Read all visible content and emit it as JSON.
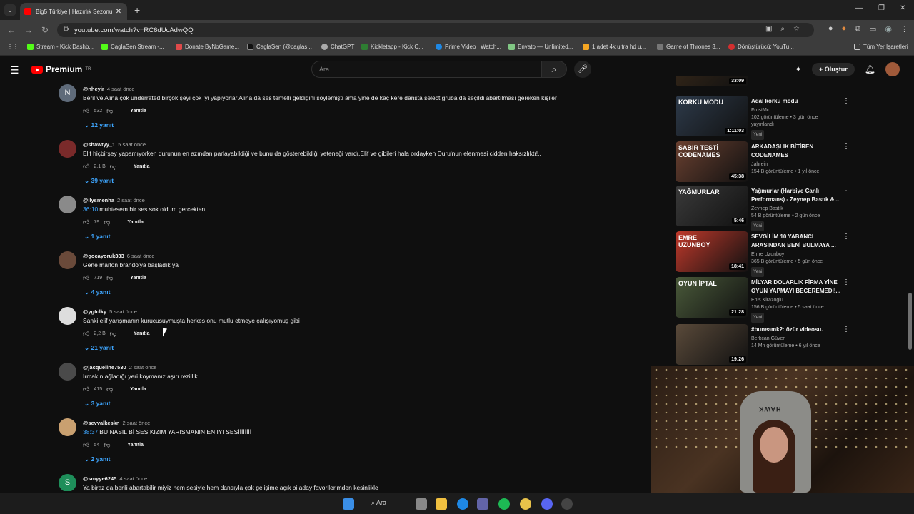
{
  "browser": {
    "tab_title": "Big5 Türkiye | Hazırlık Sezonu 5",
    "url": "youtube.com/watch?v=RC6dUcAdwQQ",
    "bookmarks": [
      "Stream - Kick Dashb...",
      "CaglaSen Stream -...",
      "Donate ByNoGame...",
      "CaglaSen (@caglas...",
      "ChatGPT",
      "Kickletapp - Kick C...",
      "Prime Video | Watch...",
      "Envato — Unlimited...",
      "1 adet 4k ultra hd u...",
      "Game of Thrones 3...",
      "Dönüştürücü: YouTu..."
    ],
    "all_bookmarks": "Tüm Yer İşaretleri"
  },
  "youtube": {
    "logo_text": "Premium",
    "logo_sup": "TR",
    "search_placeholder": "Ara",
    "create_label": "Oluştur",
    "reply_label": "Yanıtla"
  },
  "comments": [
    {
      "author": "@nheyir",
      "time": "4 saat önce",
      "text": "Beril ve Alina çok underrated birçok şeyi çok iyi yapıyorlar Alina da ses temelli geldiğini söylemişti ama yine de kaç kere dansta select gruba da seçildi abartılması gereken kişiler",
      "ts": "",
      "likes": "532",
      "replies": "12 yanıt",
      "avatar_letter": "N",
      "avatar_color": "#5f6b7a"
    },
    {
      "author": "@shawtyy_1",
      "time": "5 saat önce",
      "text": "Elif hiçbirşey yapamıyorken durunun en azından parlayabildiği ve bunu da gösterebildiği yeteneği vardı,Elif ve gibileri hala ordayken Duru'nun elenmesi cidden haksızlıktı!..",
      "ts": "",
      "likes": "2,1 B",
      "replies": "39 yanıt",
      "avatar_letter": "",
      "avatar_color": "#7a2a2a"
    },
    {
      "author": "@ilysmenha",
      "time": "2 saat önce",
      "text": "muhtesem bir ses sok oldum gercekten",
      "ts": "36:10",
      "likes": "79",
      "replies": "1 yanıt",
      "avatar_letter": "",
      "avatar_color": "#8a8a8a"
    },
    {
      "author": "@gocayoruk333",
      "time": "6 saat önce",
      "text": "Gene marlon brando'ya başladık ya",
      "ts": "",
      "likes": "719",
      "replies": "4 yanıt",
      "avatar_letter": "",
      "avatar_color": "#6a4a3a"
    },
    {
      "author": "@ygtclky",
      "time": "5 saat önce",
      "text": "Sanki elif yarışmanın kurucusuymuşta herkes onu mutlu etmeye çalışıyomuş gibi",
      "ts": "",
      "likes": "2,2 B",
      "replies": "21 yanıt",
      "avatar_letter": "",
      "avatar_color": "#dddddd"
    },
    {
      "author": "@jacqueline7530",
      "time": "2 saat önce",
      "text": "Irmakın ağladığı yeri koymanız aşırı rezillik",
      "ts": "",
      "likes": "415",
      "replies": "3 yanıt",
      "avatar_letter": "",
      "avatar_color": "#4a4a4a"
    },
    {
      "author": "@sevvalkeskn",
      "time": "2 saat önce",
      "text": "BU NASIL Bİ SES KIZIM YARISMANIN EN IYI SESİİİİİİİİ",
      "ts": "38:37",
      "likes": "54",
      "replies": "2 yanıt",
      "avatar_letter": "",
      "avatar_color": "#c9a070"
    },
    {
      "author": "@smyye6245",
      "time": "4 saat önce",
      "text": "Ya biraz da berili abartabilir miyiz hem sesiyle hem dansıyla çok gelişime açık bi aday favorilerimden kesinlikle",
      "ts": "",
      "likes": "",
      "replies": "",
      "avatar_letter": "S",
      "avatar_color": "#1e8e5a"
    }
  ],
  "related": [
    {
      "title": "",
      "channel": "",
      "meta": "30 B görüntüleme • 1 gün önce",
      "new": "Yeni",
      "duration": "33:09",
      "thumb_color": "#3a2a1a"
    },
    {
      "title": "Adal korku modu",
      "channel": "FrostMc",
      "meta": "102 görüntüleme • 3 gün önce yayınlandı",
      "new": "Yeni",
      "duration": "1:11:03",
      "thumb_color": "#2d3a4a"
    },
    {
      "title": "ARKADAŞLIK BİTİREN CODENAMES",
      "channel": "Jahrein",
      "meta": "154 B görüntüleme • 1 yıl önce",
      "new": "",
      "duration": "45:38",
      "thumb_color": "#6a4030"
    },
    {
      "title": "Yağmurlar (Harbiye Canlı Performans) - Zeynep Bastık &...",
      "channel": "Zeynep Bastık",
      "meta": "54 B görüntüleme • 2 gün önce",
      "new": "Yeni",
      "duration": "5:46",
      "thumb_color": "#3a3a3a"
    },
    {
      "title": "SEVGİLİM 10 YABANCI ARASINDAN BENİ BULMAYA ...",
      "channel": "Emre Uzunboy",
      "meta": "365 B görüntüleme • 5 gün önce",
      "new": "Yeni",
      "duration": "18:41",
      "thumb_color": "#c0392b"
    },
    {
      "title": "MİLYAR DOLARLIK FİRMA YİNE OYUN YAPMAYI BECEREMEDİ!...",
      "channel": "Enis Kirazoglu",
      "meta": "156 B görüntüleme • 5 saat önce",
      "new": "Yeni",
      "duration": "21:28",
      "thumb_color": "#4a5a3a"
    },
    {
      "title": "#buneamk2: özür videosu.",
      "channel": "Berkcan Güven",
      "meta": "14 Mn görüntüleme • 6 yıl önce",
      "new": "",
      "duration": "19:26",
      "thumb_color": "#5a4a3a"
    }
  ],
  "thumb_texts": {
    "korku": "KORKU MODU",
    "codenames": "SABIR TESTİ CODENAMES",
    "yagmurlar": "YAĞMURLAR",
    "emre": "EMRE UZUNBOY",
    "oyun": "OYUN İPTAL"
  },
  "webcam_brand": "HAWK",
  "taskbar": {
    "search_label": "Ara"
  }
}
